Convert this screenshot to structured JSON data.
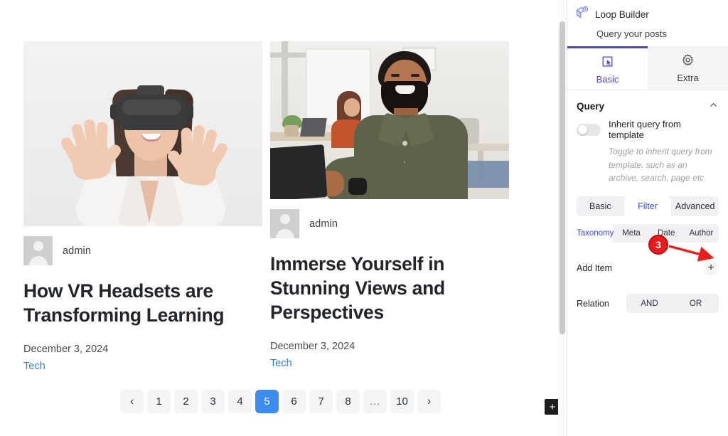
{
  "canvas": {
    "posts": [
      {
        "image_alt": "woman-vr-headset-photo",
        "author": "admin",
        "title": "How VR Headsets are Transforming Learning",
        "date": "December 3, 2024",
        "term": "Tech"
      },
      {
        "image_alt": "smiling-man-office-photo",
        "author": "admin",
        "title": "Immerse Yourself in Stunning Views and Perspectives",
        "date": "December 3, 2024",
        "term": "Tech"
      }
    ],
    "pagination": {
      "prev": "‹",
      "next": "›",
      "pages": [
        "1",
        "2",
        "3",
        "4",
        "5",
        "6",
        "7",
        "8",
        "…",
        "10"
      ],
      "active": "5"
    },
    "add_block_label": "+"
  },
  "panel": {
    "icon": "loop-builder-icon",
    "title": "Loop Builder",
    "subtitle": "Query your posts",
    "tabs": [
      {
        "label": "Basic",
        "icon": "cursor-select-icon",
        "active": true
      },
      {
        "label": "Extra",
        "icon": "gear-icon",
        "active": false
      }
    ],
    "query": {
      "section_title": "Query",
      "collapse_icon": "chevron-up-icon",
      "inherit_label": "Inherit query from template",
      "inherit_state": "off",
      "help_text": "Toggle to inherit query from template. such as an archive, search, page etc",
      "segments": [
        {
          "label": "Basic",
          "active": false
        },
        {
          "label": "Filter",
          "active": true
        },
        {
          "label": "Advanced",
          "active": false
        }
      ],
      "subtabs": [
        {
          "label": "Taxonomy",
          "active": true
        },
        {
          "label": "Meta",
          "active": false
        },
        {
          "label": "Date",
          "active": false
        },
        {
          "label": "Author",
          "active": false
        }
      ],
      "add_item": {
        "label": "Add Item",
        "button": "+"
      },
      "relation": {
        "label": "Relation",
        "options": [
          {
            "label": "AND",
            "active": false
          },
          {
            "label": "OR",
            "active": false
          }
        ]
      }
    }
  },
  "annotation": {
    "step_number": "3",
    "color": "#ee1b1b"
  }
}
